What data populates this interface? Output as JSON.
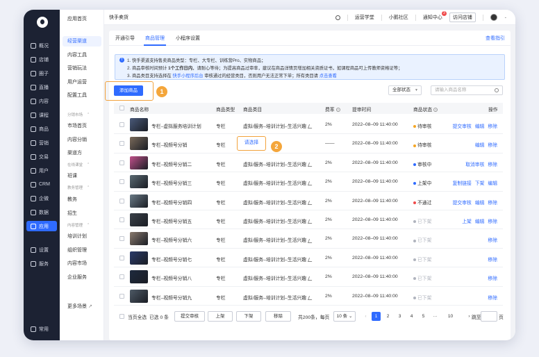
{
  "iconbar": {
    "items": [
      {
        "label": "概况",
        "icon": "overview-icon"
      },
      {
        "label": "店铺",
        "icon": "store-icon"
      },
      {
        "label": "圈子",
        "icon": "circle-icon"
      },
      {
        "label": "直播",
        "icon": "live-icon"
      },
      {
        "label": "内容",
        "icon": "content-icon"
      },
      {
        "label": "课程",
        "icon": "course-icon"
      },
      {
        "label": "商品",
        "icon": "goods-icon"
      },
      {
        "label": "营销",
        "icon": "marketing-icon"
      },
      {
        "label": "交易",
        "icon": "trade-icon"
      },
      {
        "label": "用户",
        "icon": "user-icon"
      },
      {
        "label": "CRM",
        "icon": "crm-icon"
      },
      {
        "label": "企微",
        "icon": "wecom-icon"
      },
      {
        "label": "数据",
        "icon": "data-icon"
      },
      {
        "label": "应用",
        "icon": "apps-icon",
        "active": true
      },
      {
        "label": "设置",
        "icon": "settings-icon"
      },
      {
        "label": "服务",
        "icon": "service-icon"
      },
      {
        "label": "常用",
        "icon": "frequent-icon"
      }
    ]
  },
  "subnav": {
    "home": "应用首页",
    "items_top": [
      "经营渠道",
      "内容工具",
      "营销玩法",
      "用户运营",
      "配置工具"
    ],
    "group1": "分销市场",
    "group1_items": [
      "市场首页",
      "内容分销",
      "渠道方"
    ],
    "group2": "在线课堂",
    "group2_items": [
      "班课"
    ],
    "group3": "教务管理",
    "group3_items": [
      "教务",
      "招生"
    ],
    "group4": "内容管理",
    "group4_items": [
      "培训计划",
      "组织管理",
      "内容市场",
      "企业服务"
    ],
    "more": "更多场景"
  },
  "topbar": {
    "title": "快手卖货",
    "links": [
      "运营学堂",
      "小鹅社区",
      "通知中心"
    ],
    "notice_badge": "3",
    "visit_store": "访问店铺"
  },
  "tabs": {
    "items": [
      "开通引导",
      "商品管理",
      "小程序设置"
    ],
    "active": 1,
    "link": "查看指引"
  },
  "notice": {
    "line1": "1. 快手渠道支持售卖商品类型：专栏、大专栏、训练营Pro、实物商品；",
    "line2_a": "2. 商品审核时间预计 ",
    "line2_b": "1个工作日内",
    "line2_c": "，请耐心等待；为提高商品过审率，建议在商品详情页增加相关资质证书，如课程商品可上传教师资格证等；",
    "line3_a": "3. 商品类目支持选择在 ",
    "line3_link1": "快手小程序后台",
    "line3_b": " 审核通过的经营类目，否则用户无法正常下单；所有类目请 ",
    "line3_link2": "点击查看"
  },
  "toolbar": {
    "add_button": "添加商品",
    "status_select": "全部状态",
    "search_placeholder": "请输入商品名称",
    "callout1": "1",
    "callout2": "2"
  },
  "table": {
    "headers": [
      "商品名称",
      "商品类型",
      "商品类目",
      "费率",
      "提审时间",
      "商品状态",
      "操作"
    ],
    "rows": [
      {
        "name": "专栏–虚拟服务培训计划",
        "type": "专栏",
        "category": "虚拟/服务–培训计划–生活兴趣",
        "rate": "2%",
        "time": "2022–08–09 11:40:00",
        "status": "待审核",
        "status_color": "#f5a623",
        "actions": [
          "提交审核",
          "编辑",
          "移除"
        ],
        "thumb": "#4a5a7a"
      },
      {
        "name": "专栏–视频号分销",
        "type": "专栏",
        "category": "请选择",
        "rate": "——",
        "time": "2022–08–09 11:40:00",
        "status": "待审核",
        "status_color": "#f5a623",
        "actions": [
          "编辑",
          "移除"
        ],
        "thumb": "#7a6a5a"
      },
      {
        "name": "专栏–视频号分销二",
        "type": "专栏",
        "category": "虚拟/服务–培训计划–生活兴趣",
        "rate": "2%",
        "time": "2022–08–09 11:40:00",
        "status": "审核中",
        "status_color": "#2f6bff",
        "actions": [
          "取消审核",
          "移除"
        ],
        "thumb": "#c0508a"
      },
      {
        "name": "专栏–视频号分销三",
        "type": "专栏",
        "category": "虚拟/服务–培训计划–生活兴趣",
        "rate": "2%",
        "time": "2022–08–09 11:40:00",
        "status": "上架中",
        "status_color": "#2f6bff",
        "actions": [
          "复制链接",
          "下架",
          "编辑"
        ],
        "thumb": "#5a6a72"
      },
      {
        "name": "专栏–视频号分销四",
        "type": "专栏",
        "category": "虚拟/服务–培训计划–生活兴趣",
        "rate": "2%",
        "time": "2022–08–09 11:40:00",
        "status": "不通过",
        "status_color": "#f04b4b",
        "actions": [
          "提交审核",
          "编辑",
          "移除"
        ],
        "thumb": "#6a7a86"
      },
      {
        "name": "专栏–视频号分销五",
        "type": "专栏",
        "category": "虚拟/服务–培训计划–生活兴趣",
        "rate": "2%",
        "time": "2022–08–09 11:40:00",
        "status": "已下架",
        "status_color": "#b0b4be",
        "actions": [
          "上架",
          "编辑",
          "移除"
        ],
        "thumb": "#3a4048"
      },
      {
        "name": "专栏–视频号分销六",
        "type": "专栏",
        "category": "虚拟/服务–培训计划–生活兴趣",
        "rate": "2%",
        "time": "2022–08–09 11:40:00",
        "status": "已下架",
        "status_color": "#b0b4be",
        "actions": [
          "移除"
        ],
        "thumb": "#8a7a6e"
      },
      {
        "name": "专栏–视频号分销七",
        "type": "专栏",
        "category": "虚拟/服务–培训计划–生活兴趣",
        "rate": "2%",
        "time": "2022–08–09 11:40:00",
        "status": "已下架",
        "status_color": "#b0b4be",
        "actions": [
          "移除"
        ],
        "thumb": "#2a3a6a"
      },
      {
        "name": "专栏–视频号分销八",
        "type": "专栏",
        "category": "虚拟/服务–培训计划–生活兴趣",
        "rate": "2%",
        "time": "2022–08–09 11:40:00",
        "status": "已下架",
        "status_color": "#b0b4be",
        "actions": [
          "移除"
        ],
        "thumb": "#1e2a3e"
      },
      {
        "name": "专栏–视频号分销九",
        "type": "专栏",
        "category": "虚拟/服务–培训计划–生活兴趣",
        "rate": "2%",
        "time": "2022–08–09 11:40:00",
        "status": "已下架",
        "status_color": "#b0b4be",
        "actions": [
          "移除"
        ],
        "thumb": "#4e5a66"
      }
    ]
  },
  "footer": {
    "select_all": "当页全选",
    "selected": "已选 0 条",
    "buttons": [
      "提交审核",
      "上架",
      "下架",
      "移除"
    ],
    "total": "共200条，每页",
    "per_page": "10 条",
    "pages": [
      "1",
      "2",
      "3",
      "4",
      "5",
      "···",
      "10"
    ],
    "prev": "‹",
    "next": "›",
    "jump": "跳至",
    "page_unit": "页"
  }
}
